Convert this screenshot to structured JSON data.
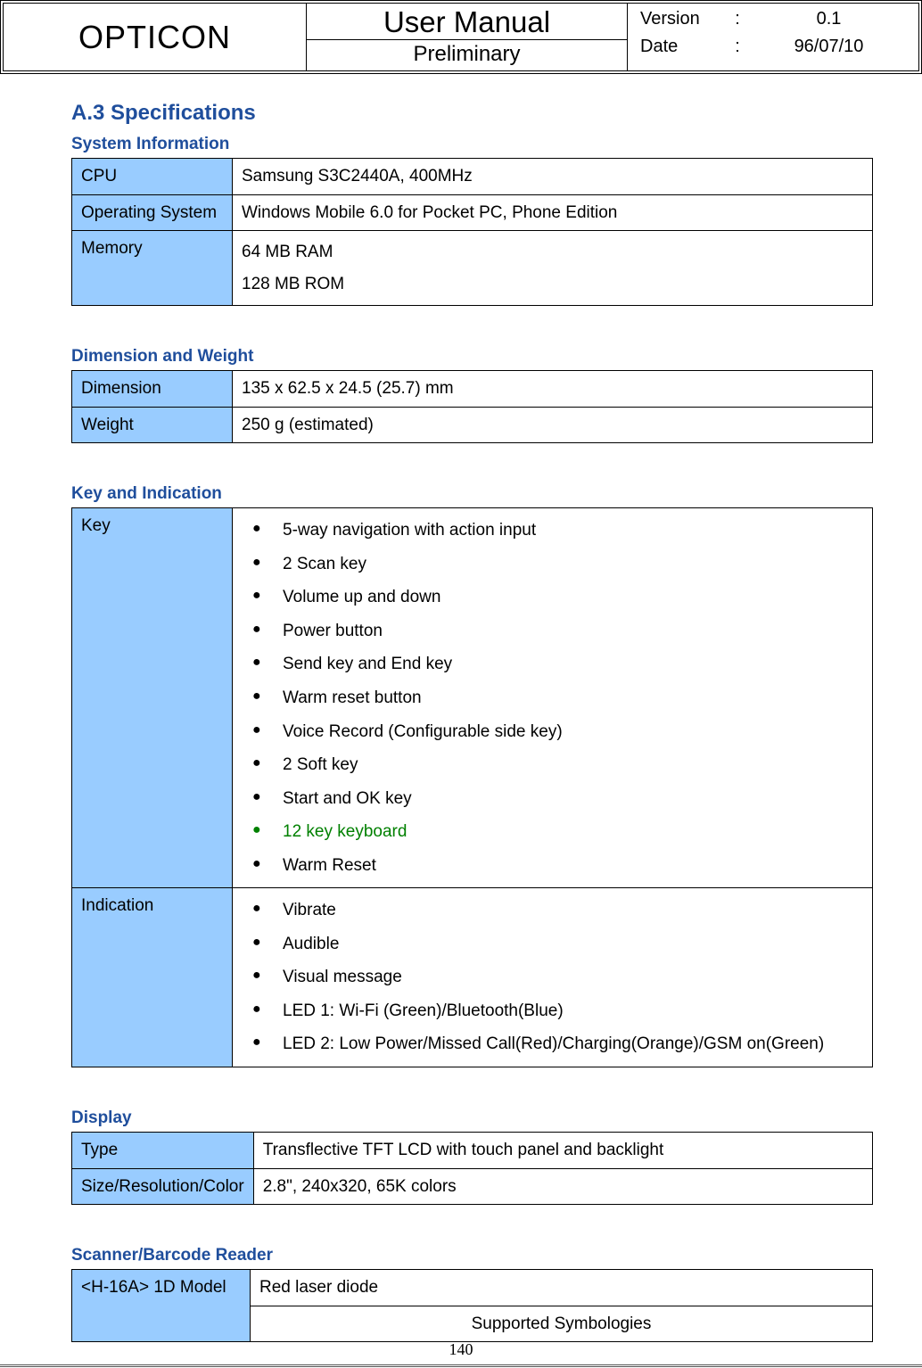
{
  "header": {
    "brand": "OPTICON",
    "title": "User Manual",
    "subtitle": "Preliminary",
    "version_label": "Version",
    "version_value": "0.1",
    "date_label": "Date",
    "date_value": "96/07/10"
  },
  "main_heading": "A.3 Specifications",
  "sections": {
    "system_info": {
      "title": "System Information",
      "rows": {
        "cpu": {
          "label": "CPU",
          "value": "Samsung S3C2440A, 400MHz"
        },
        "os": {
          "label": "Operating System",
          "value": "Windows Mobile 6.0 for Pocket PC, Phone Edition"
        },
        "memory": {
          "label": "Memory",
          "value1": "64 MB RAM",
          "value2": "128 MB ROM"
        }
      }
    },
    "dimension_weight": {
      "title": "Dimension and Weight",
      "rows": {
        "dimension": {
          "label": "Dimension",
          "value": "135 x 62.5 x 24.5 (25.7) mm"
        },
        "weight": {
          "label": "Weight",
          "value": "250 g (estimated)"
        }
      }
    },
    "key_indication": {
      "title": "Key and Indication",
      "key_label": "Key",
      "key_items": [
        "5-way navigation with action input",
        "2 Scan key",
        "Volume up and down",
        "Power button",
        "Send key and End key",
        "Warm reset button",
        "Voice Record (Configurable side key)",
        "2 Soft key",
        "Start and OK key",
        "12 key keyboard",
        "Warm Reset"
      ],
      "key_green_index": 9,
      "indication_label": "Indication",
      "indication_items": [
        "Vibrate",
        "Audible",
        "Visual message",
        "LED 1: Wi-Fi (Green)/Bluetooth(Blue)",
        "LED 2: Low Power/Missed Call(Red)/Charging(Orange)/GSM on(Green)"
      ]
    },
    "display": {
      "title": "Display",
      "rows": {
        "type": {
          "label": "Type",
          "value": "Transflective TFT LCD with touch panel and backlight"
        },
        "src": {
          "label": "Size/Resolution/Color",
          "value": "2.8\", 240x320, 65K colors"
        }
      }
    },
    "scanner": {
      "title": "Scanner/Barcode Reader",
      "rows": {
        "model": {
          "label": "<H-16A> 1D Model",
          "value1": "Red laser diode",
          "value2": "Supported Symbologies"
        }
      }
    }
  },
  "page_number": "140"
}
